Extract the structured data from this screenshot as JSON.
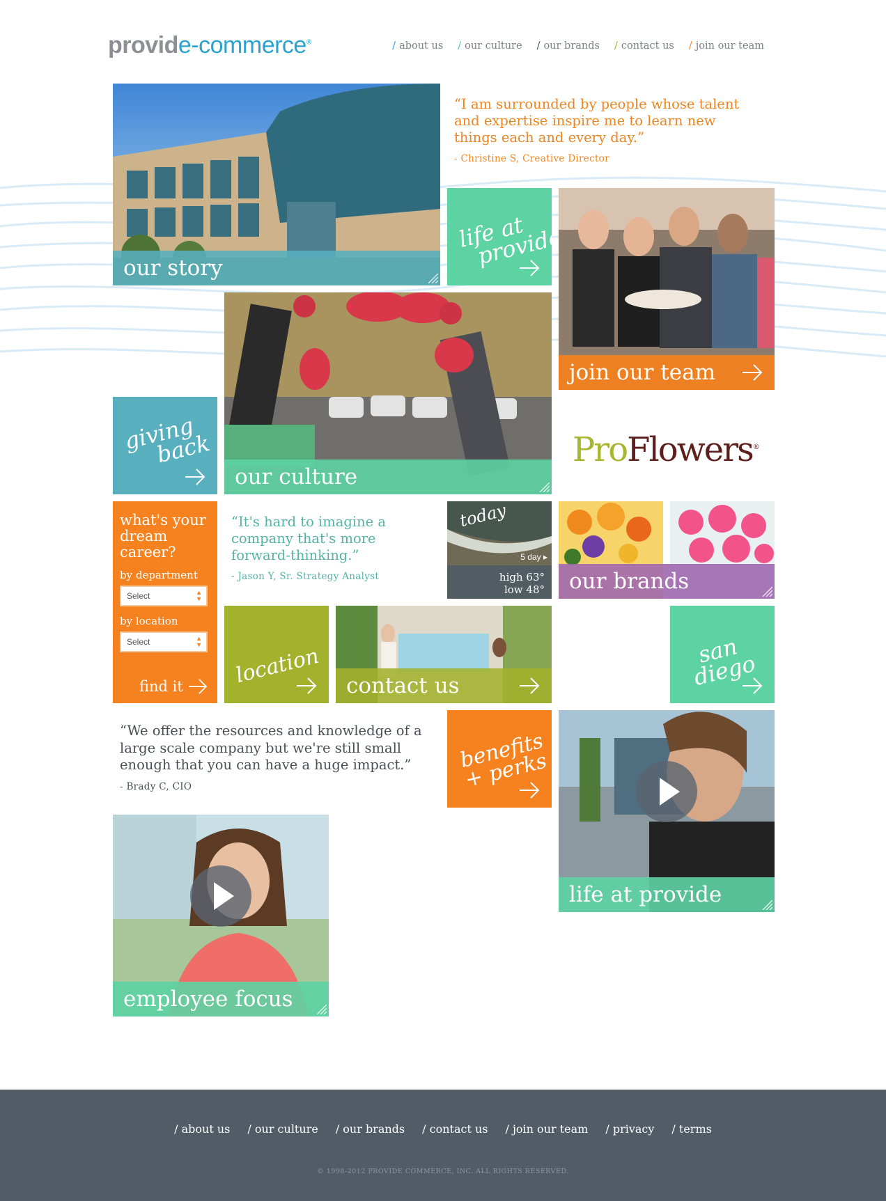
{
  "header": {
    "logo": {
      "part1": "provid",
      "part2": "e-commerce",
      "mark": "®"
    },
    "nav": [
      {
        "slash": "/",
        "label": "about us",
        "slash_color": "#2aa3d0"
      },
      {
        "slash": "/",
        "label": "our culture",
        "slash_color": "#56c8a4"
      },
      {
        "slash": "/",
        "label": "our brands",
        "slash_color": "#4a4f56"
      },
      {
        "slash": "/",
        "label": "contact us",
        "slash_color": "#a3b22c"
      },
      {
        "slash": "/",
        "label": "join our team",
        "slash_color": "#f5821f"
      }
    ]
  },
  "tiles": {
    "our_story": "our story",
    "life_at_provide_script": {
      "line1": "life at",
      "line2": "provide"
    },
    "join_our_team": "join our team",
    "giving_back_script": {
      "line1": "giving",
      "line2": "back"
    },
    "our_culture": "our culture",
    "proflowers": {
      "pro": "Pro",
      "flowers": "Flowers",
      "mark": "®"
    },
    "our_brands": "our brands",
    "location_script": "location",
    "contact_us": "contact us",
    "san_diego_script": {
      "line1": "san",
      "line2": "diego"
    },
    "benefits_script": {
      "line1": "benefits",
      "line2": "+ perks"
    },
    "life_at_provide": "life at provide",
    "employee_focus": "employee focus"
  },
  "weather": {
    "today": "today",
    "five_day": "5 day",
    "high": "high 63°",
    "low": "low 48°"
  },
  "quotes": {
    "christine": {
      "text": "“I am surrounded by people whose talent and expertise inspire me to learn new things each and every day.”",
      "by": "- Christine S, Creative Director"
    },
    "jason": {
      "text": "“It's hard to imagine a company that's more forward-thinking.”",
      "by": "- Jason Y, Sr. Strategy Analyst"
    },
    "brady": {
      "text": "“We offer the resources and knowledge of a large scale company but we're still small enough that you can have a huge impact.”",
      "by": "- Brady C, CIO"
    }
  },
  "career": {
    "title": "what's your dream career?",
    "by_department": "by department",
    "department_select": "Select",
    "by_location": "by location",
    "location_select": "Select",
    "find_it": "find it"
  },
  "footer": {
    "nav": [
      {
        "slash": "/",
        "label": "about us"
      },
      {
        "slash": "/",
        "label": "our culture"
      },
      {
        "slash": "/",
        "label": "our brands"
      },
      {
        "slash": "/",
        "label": "contact us"
      },
      {
        "slash": "/",
        "label": "join our team"
      },
      {
        "slash": "/",
        "label": "privacy"
      },
      {
        "slash": "/",
        "label": "terms"
      }
    ],
    "copyright": "© 1998-2012 PROVIDE COMMERCE, INC. ALL RIGHTS RESERVED."
  },
  "colors": {
    "teal": "#58afbe",
    "green": "#5dd2a3",
    "orange": "#f5821f",
    "purple": "#a068af",
    "olive": "#a3b22c",
    "footer": "#525c66",
    "logo_gray": "#8c8f93",
    "logo_blue": "#2aa3d0"
  },
  "icons": [
    "arrow-right-icon",
    "corner-stripes-icon",
    "play-icon",
    "select-updown-icon"
  ]
}
